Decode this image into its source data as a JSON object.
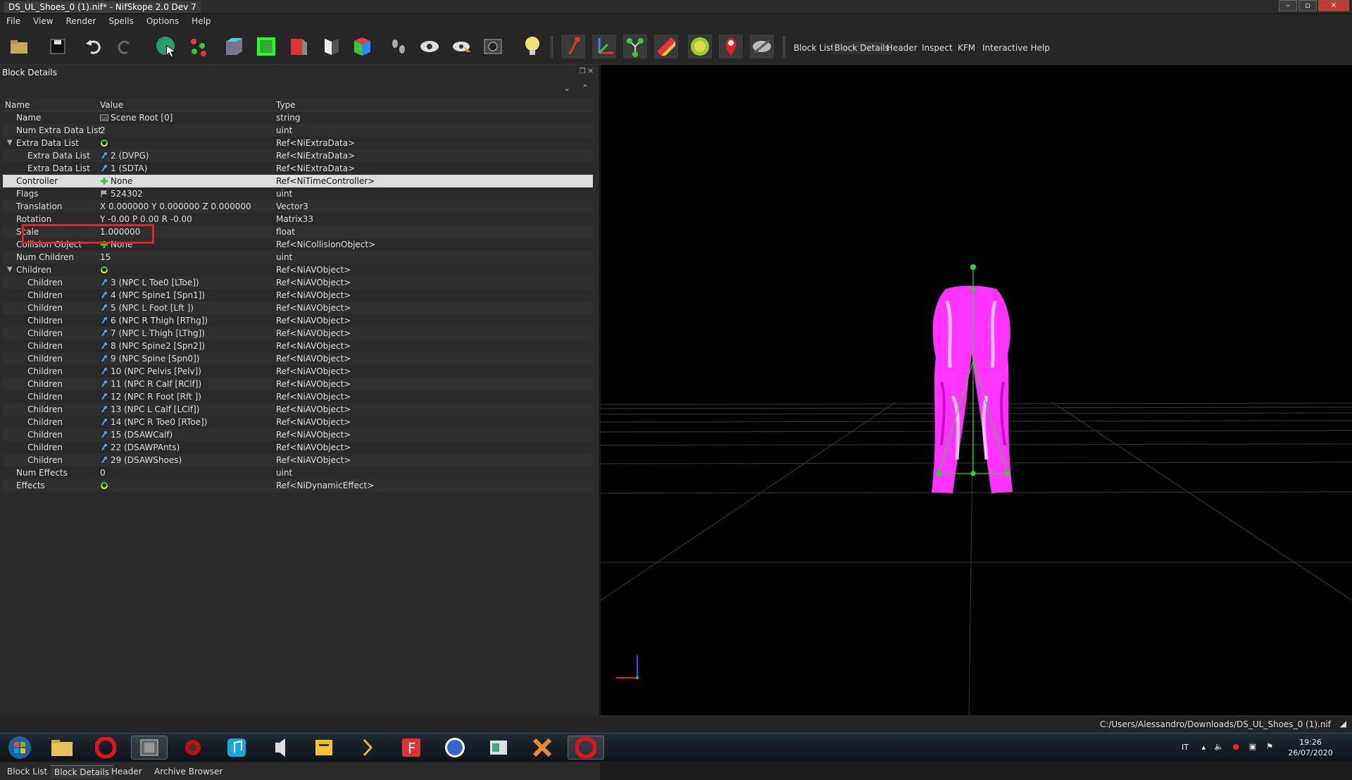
{
  "window": {
    "title": "DS_UL_Shoes_0 (1).nif* - NifSkope 2.0 Dev 7"
  },
  "menu": [
    "File",
    "View",
    "Render",
    "Spells",
    "Options",
    "Help"
  ],
  "toolbar_tabs": [
    "Block List",
    "Block Details",
    "Header",
    "Inspect",
    "KFM",
    "Interactive Help"
  ],
  "panel": {
    "title": "Block Details"
  },
  "columns": {
    "name": "Name",
    "value": "Value",
    "type": "Type"
  },
  "rows": [
    {
      "name": "Name",
      "value": "Scene Root [0]",
      "type": "string",
      "indent": 1,
      "icon": "txt-icon"
    },
    {
      "name": "Num Extra Data List",
      "value": "2",
      "type": "uint",
      "indent": 1
    },
    {
      "name": "Extra Data List",
      "value": "",
      "type": "Ref<NiExtraData>",
      "indent": 1,
      "icon": "refresh-icon",
      "expand": true
    },
    {
      "name": "Extra Data List",
      "value": "2 (DVPG)",
      "type": "Ref<NiExtraData>",
      "indent": 2,
      "icon": "link-icon"
    },
    {
      "name": "Extra Data List",
      "value": "1 (SDTA)",
      "type": "Ref<NiExtraData>",
      "indent": 2,
      "icon": "link-icon"
    },
    {
      "name": "Controller",
      "value": "None",
      "type": "Ref<NiTimeController>",
      "indent": 1,
      "icon": "plus-icon",
      "selected": true
    },
    {
      "name": "Flags",
      "value": "524302",
      "type": "uint",
      "indent": 1,
      "icon": "flag-icon"
    },
    {
      "name": "Translation",
      "value": "X 0.000000 Y 0.000000 Z 0.000000",
      "type": "Vector3",
      "indent": 1
    },
    {
      "name": "Rotation",
      "value": "Y -0.00 P 0.00 R -0.00",
      "type": "Matrix33",
      "indent": 1
    },
    {
      "name": "Scale",
      "value": "1.000000",
      "type": "float",
      "indent": 1
    },
    {
      "name": "Collision Object",
      "value": "None",
      "type": "Ref<NiCollisionObject>",
      "indent": 1,
      "icon": "plus-icon"
    },
    {
      "name": "Num Children",
      "value": "15",
      "type": "uint",
      "indent": 1
    },
    {
      "name": "Children",
      "value": "",
      "type": "Ref<NiAVObject>",
      "indent": 1,
      "icon": "refresh-icon",
      "expand": true
    },
    {
      "name": "Children",
      "value": "3 (NPC L Toe0 [LToe])",
      "type": "Ref<NiAVObject>",
      "indent": 2,
      "icon": "link-icon"
    },
    {
      "name": "Children",
      "value": "4 (NPC Spine1 [Spn1])",
      "type": "Ref<NiAVObject>",
      "indent": 2,
      "icon": "link-icon"
    },
    {
      "name": "Children",
      "value": "5 (NPC L Foot [Lft ])",
      "type": "Ref<NiAVObject>",
      "indent": 2,
      "icon": "link-icon"
    },
    {
      "name": "Children",
      "value": "6 (NPC R Thigh [RThg])",
      "type": "Ref<NiAVObject>",
      "indent": 2,
      "icon": "link-icon"
    },
    {
      "name": "Children",
      "value": "7 (NPC L Thigh [LThg])",
      "type": "Ref<NiAVObject>",
      "indent": 2,
      "icon": "link-icon"
    },
    {
      "name": "Children",
      "value": "8 (NPC Spine2 [Spn2])",
      "type": "Ref<NiAVObject>",
      "indent": 2,
      "icon": "link-icon"
    },
    {
      "name": "Children",
      "value": "9 (NPC Spine [Spn0])",
      "type": "Ref<NiAVObject>",
      "indent": 2,
      "icon": "link-icon"
    },
    {
      "name": "Children",
      "value": "10 (NPC Pelvis [Pelv])",
      "type": "Ref<NiAVObject>",
      "indent": 2,
      "icon": "link-icon"
    },
    {
      "name": "Children",
      "value": "11 (NPC R Calf [RClf])",
      "type": "Ref<NiAVObject>",
      "indent": 2,
      "icon": "link-icon"
    },
    {
      "name": "Children",
      "value": "12 (NPC R Foot [Rft ])",
      "type": "Ref<NiAVObject>",
      "indent": 2,
      "icon": "link-icon"
    },
    {
      "name": "Children",
      "value": "13 (NPC L Calf [LClf])",
      "type": "Ref<NiAVObject>",
      "indent": 2,
      "icon": "link-icon"
    },
    {
      "name": "Children",
      "value": "14 (NPC R Toe0 [RToe])",
      "type": "Ref<NiAVObject>",
      "indent": 2,
      "icon": "link-icon"
    },
    {
      "name": "Children",
      "value": "15 (DSAWCalf)",
      "type": "Ref<NiAVObject>",
      "indent": 2,
      "icon": "link-icon"
    },
    {
      "name": "Children",
      "value": "22 (DSAWPAnts)",
      "type": "Ref<NiAVObject>",
      "indent": 2,
      "icon": "link-icon"
    },
    {
      "name": "Children",
      "value": "29 (DSAWShoes)",
      "type": "Ref<NiAVObject>",
      "indent": 2,
      "icon": "link-icon"
    },
    {
      "name": "Num Effects",
      "value": "0",
      "type": "uint",
      "indent": 1
    },
    {
      "name": "Effects",
      "value": "",
      "type": "Ref<NiDynamicEffect>",
      "indent": 1,
      "icon": "refresh-icon"
    }
  ],
  "bottom_tabs": [
    "Block List",
    "Block Details",
    "Header",
    "Archive Browser"
  ],
  "status": {
    "path": "C:/Users/Alessandro/Downloads/DS_UL_Shoes_0 (1).nif"
  },
  "tray": {
    "lang": "IT",
    "time": "19:26",
    "date": "26/07/2020"
  },
  "colors": {
    "mesh": "#ff33ff",
    "skeleton": "#22dd22",
    "selection_highlight": "#e0262d"
  }
}
